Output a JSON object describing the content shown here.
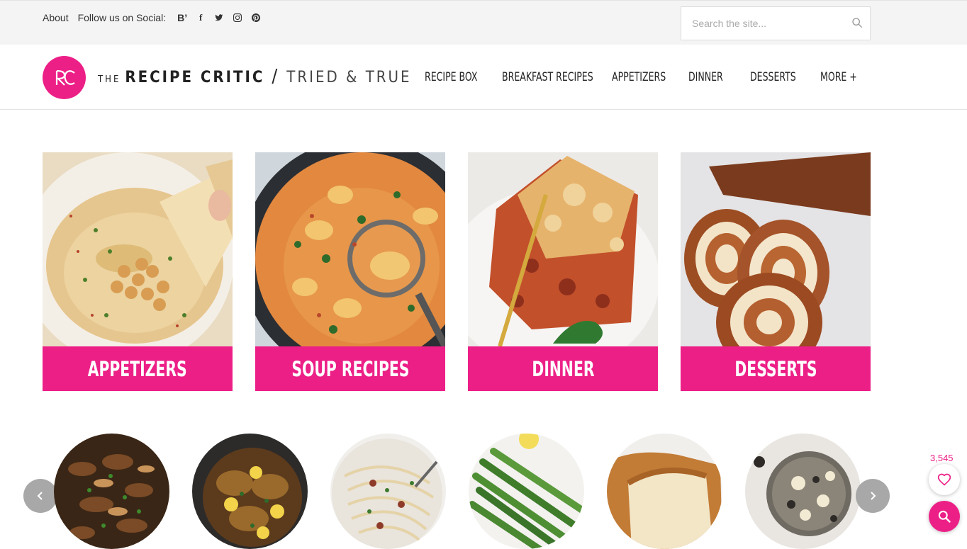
{
  "topbar": {
    "about": "About",
    "follow_text": "Follow us on Social:",
    "social": [
      {
        "icon": "bloglovin-icon",
        "glyph": "B’"
      },
      {
        "icon": "facebook-icon",
        "glyph": "f"
      },
      {
        "icon": "twitter-icon",
        "glyph": ""
      },
      {
        "icon": "instagram-icon",
        "glyph": ""
      },
      {
        "icon": "pinterest-icon",
        "glyph": ""
      }
    ],
    "search_placeholder": "Search the site..."
  },
  "header": {
    "logo_the": "THE",
    "logo_name": "RECIPE CRITIC",
    "logo_slash": "/",
    "logo_tagline": "TRIED & TRUE",
    "nav": [
      {
        "label": "RECIPE BOX"
      },
      {
        "label": "BREAKFAST RECIPES"
      },
      {
        "label": "APPETIZERS"
      },
      {
        "label": "DINNER"
      },
      {
        "label": "DESSERTS"
      },
      {
        "label": "MORE +"
      }
    ]
  },
  "categories": [
    {
      "label": "APPETIZERS"
    },
    {
      "label": "SOUP RECIPES"
    },
    {
      "label": "DINNER"
    },
    {
      "label": "DESSERTS"
    }
  ],
  "carousel": {
    "items": [
      {
        "name": "mushroom-dish"
      },
      {
        "name": "lemon-chicken"
      },
      {
        "name": "creamy-pasta"
      },
      {
        "name": "asparagus"
      },
      {
        "name": "bread-loaf"
      },
      {
        "name": "cookies-and-cream-cookies"
      }
    ]
  },
  "floating": {
    "share_count": "3,545"
  },
  "colors": {
    "brand_pink": "#ec1f87",
    "topbar_bg": "#f4f4f4"
  }
}
